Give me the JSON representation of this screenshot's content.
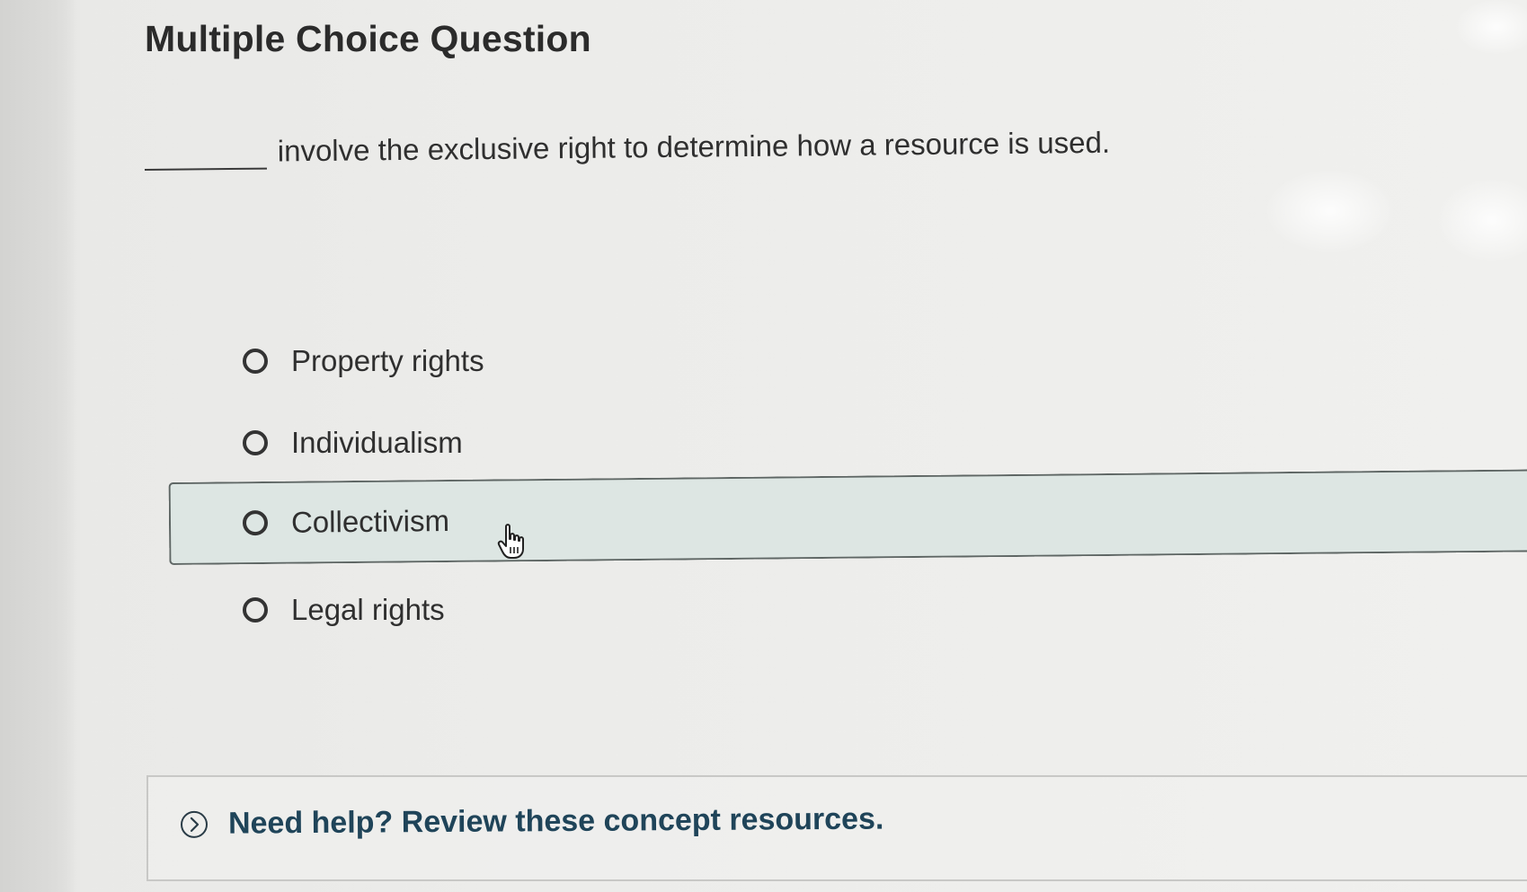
{
  "page": {
    "title": "Multiple Choice Question"
  },
  "question": {
    "text": "involve the exclusive right to determine how a resource is used."
  },
  "options": [
    {
      "label": "Property rights",
      "selected": false,
      "hovered": false
    },
    {
      "label": "Individualism",
      "selected": false,
      "hovered": false
    },
    {
      "label": "Collectivism",
      "selected": false,
      "hovered": true
    },
    {
      "label": "Legal rights",
      "selected": false,
      "hovered": false
    }
  ],
  "help": {
    "text": "Need help? Review these concept resources.",
    "icon": "chevron-right-circle-icon"
  },
  "colors": {
    "hover_background": "#dde6e3",
    "help_text": "#1f4459"
  },
  "cursor": {
    "icon": "hand-pointer-icon"
  }
}
